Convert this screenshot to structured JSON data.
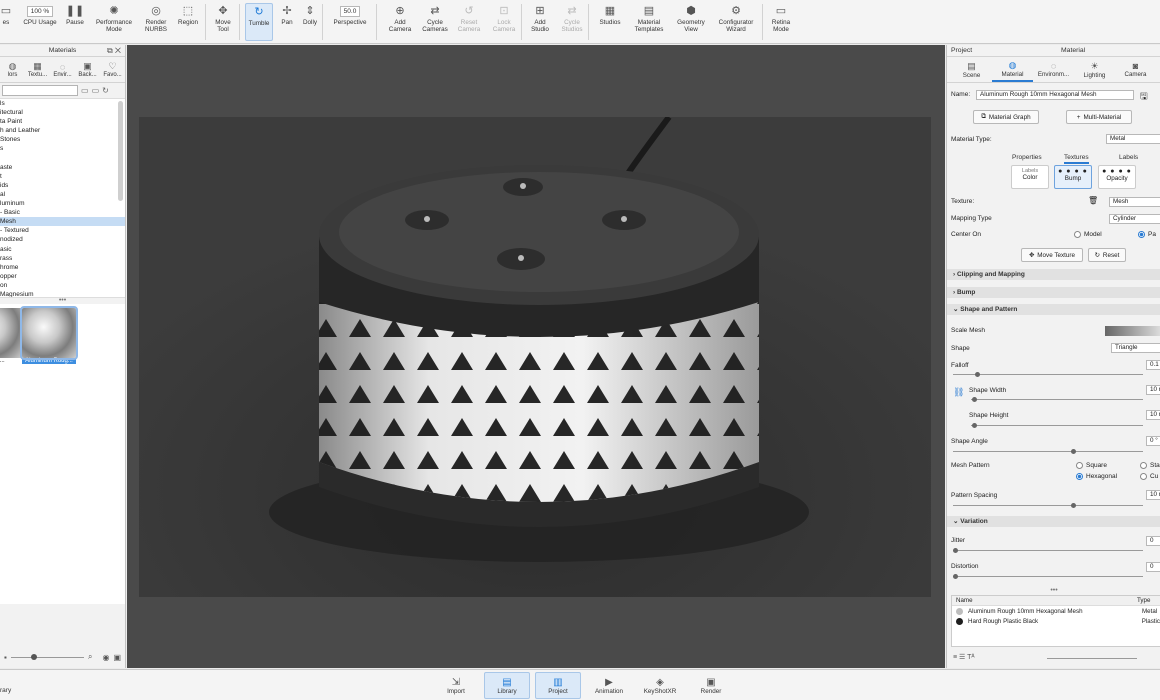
{
  "toolbar": {
    "items": [
      {
        "label": "es",
        "icon": "partial-icon"
      },
      {
        "label": "CPU Usage",
        "icon": "cpu-dropdown",
        "field": "100 %"
      },
      {
        "label": "Pause",
        "icon": "pause-icon"
      },
      {
        "label": "Performance\nMode",
        "icon": "performance-icon"
      },
      {
        "label": "Render\nNURBS",
        "icon": "nurbs-icon"
      },
      {
        "label": "Region",
        "icon": "region-icon"
      },
      {
        "label": "Move\nTool",
        "icon": "move-tool-icon"
      },
      {
        "label": "Tumble",
        "icon": "tumble-icon",
        "active": true
      },
      {
        "label": "Pan",
        "icon": "pan-icon"
      },
      {
        "label": "Dolly",
        "icon": "dolly-icon"
      },
      {
        "label": "Perspective",
        "icon": "perspective-icon",
        "field": "50.0"
      },
      {
        "label": "Add\nCamera",
        "icon": "add-camera-icon"
      },
      {
        "label": "Cycle\nCameras",
        "icon": "cycle-cameras-icon"
      },
      {
        "label": "Reset\nCamera",
        "icon": "reset-camera-icon",
        "disabled": true
      },
      {
        "label": "Lock\nCamera",
        "icon": "lock-camera-icon",
        "disabled": true
      },
      {
        "label": "Add\nStudio",
        "icon": "add-studio-icon"
      },
      {
        "label": "Cycle\nStudios",
        "icon": "cycle-studios-icon",
        "disabled": true
      },
      {
        "label": "Studios",
        "icon": "studios-icon"
      },
      {
        "label": "Material\nTemplates",
        "icon": "material-templates-icon"
      },
      {
        "label": "Geometry\nView",
        "icon": "geometry-view-icon"
      },
      {
        "label": "Configurator\nWizard",
        "icon": "configurator-icon"
      },
      {
        "label": "Retina\nMode",
        "icon": "retina-icon"
      }
    ]
  },
  "library": {
    "title": "Materials",
    "tabs": [
      "lors",
      "Textu...",
      "Envir...",
      "Back...",
      "Favo..."
    ],
    "tree": [
      "ls",
      "itectural",
      "ta Paint",
      "h and Leather",
      "Stones",
      "s",
      "",
      "aste",
      "t",
      "ids",
      "al",
      "luminum",
      "- Basic",
      "Mesh",
      "- Textured",
      "nodized",
      "asic",
      "rass",
      "hrome",
      "opper",
      "on",
      "Magnesium"
    ],
    "selected_index": 13,
    "thumbs": [
      {
        "caption": "Roug..."
      },
      {
        "caption": "Aluminum Roug...",
        "selected": true
      }
    ]
  },
  "properties": {
    "head_left": "Project",
    "head_center": "Material",
    "tabs": [
      "Scene",
      "Material",
      "Environm...",
      "Lighting",
      "Camera"
    ],
    "name_label": "Name:",
    "name_value": "Aluminum Rough 10mm Hexagonal Mesh",
    "material_graph": "Material Graph",
    "multi_material": "Multi-Material",
    "type_label": "Material Type:",
    "type_value": "Metal",
    "subtabs": [
      "Properties",
      "Textures",
      "Labels"
    ],
    "tex_cards": [
      "Color",
      "Bump",
      "Opacity"
    ],
    "tex_card_top": "Labels",
    "texture_label": "Texture:",
    "texture_value": "Mesh",
    "mapping_label": "Mapping Type",
    "mapping_value": "Cylinder",
    "center_label": "Center On",
    "center_model": "Model",
    "center_part": "Pa",
    "move_texture": "Move Texture",
    "reset": "Reset",
    "sections": [
      "Clipping and Mapping",
      "Bump",
      "Shape and Pattern",
      "Variation"
    ],
    "scale_mesh": "Scale Mesh",
    "shape_label": "Shape",
    "shape_value": "Triangle",
    "falloff_label": "Falloff",
    "falloff_value": "0.1",
    "shape_width": "Shape Width",
    "shape_width_value": "10 r",
    "shape_height": "Shape Height",
    "shape_height_value": "10 r",
    "shape_angle": "Shape Angle",
    "shape_angle_value": "0 °",
    "mesh_pattern": "Mesh Pattern",
    "pattern_square": "Square",
    "pattern_hexagonal": "Hexagonal",
    "pattern_sta": "Sta",
    "pattern_cu": "Cu",
    "pattern_spacing": "Pattern Spacing",
    "pattern_spacing_value": "10 r",
    "jitter": "Jitter",
    "jitter_value": "0",
    "distortion": "Distortion",
    "distortion_value": "0",
    "list_header": [
      "Name",
      "Type"
    ],
    "list_rows": [
      {
        "name": "Aluminum Rough 10mm Hexagonal Mesh",
        "type": "Metal",
        "color": "#bdbdbd"
      },
      {
        "name": "Hard Rough Plastic Black",
        "type": "Plastic",
        "color": "#1e1e1e"
      }
    ]
  },
  "bottom": {
    "status_left": "rary",
    "buttons": [
      {
        "label": "Import",
        "icon": "import-icon"
      },
      {
        "label": "Library",
        "icon": "library-icon",
        "active": true
      },
      {
        "label": "Project",
        "icon": "project-icon",
        "active": true
      },
      {
        "label": "Animation",
        "icon": "animation-icon"
      },
      {
        "label": "KeyShotXR",
        "icon": "keyshotxr-icon"
      },
      {
        "label": "Render",
        "icon": "render-icon"
      }
    ]
  }
}
